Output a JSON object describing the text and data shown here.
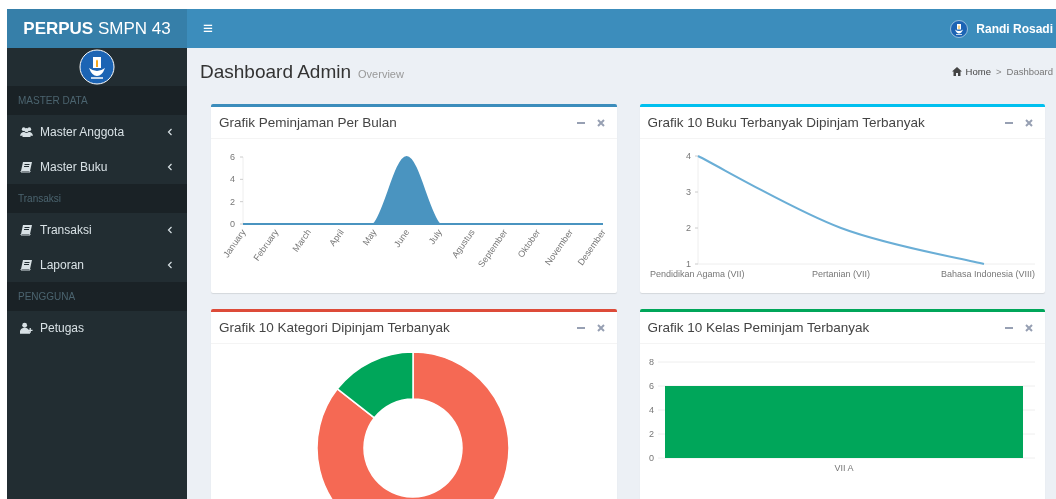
{
  "header": {
    "brand": "**PERPUS** SMPN 43",
    "menu_toggle": "≡",
    "user_name": "Randi Rosadi"
  },
  "sidebar": {
    "sections": [
      {
        "header": "MASTER DATA",
        "items": [
          {
            "label": "Master Anggota",
            "kind": "users",
            "expanded": false
          },
          {
            "label": "Master Buku",
            "kind": "book",
            "expanded": false
          }
        ]
      },
      {
        "header": "Transaksi",
        "items": [
          {
            "label": "Transaksi",
            "kind": "book",
            "expanded": false
          },
          {
            "label": "Laporan",
            "kind": "book",
            "expanded": false
          }
        ]
      },
      {
        "header": "PENGGUNA",
        "items": [
          {
            "label": "Petugas",
            "kind": "adduser"
          }
        ]
      }
    ]
  },
  "page_header": {
    "title": "Dashboard Admin",
    "subtitle": "Overview",
    "breadcrumb": [
      {
        "label": "Home"
      },
      {
        "label": "Dashboard"
      }
    ],
    "separator": ">"
  },
  "cards": [
    {
      "title": "Grafik Peminjaman Per Bulan",
      "color": "#3c8dbc",
      "chart_data": {
        "type": "area",
        "categories": [
          "January",
          "February",
          "March",
          "April",
          "May",
          "June",
          "July",
          "Agustus",
          "September",
          "Oktober",
          "November",
          "Desember"
        ],
        "series": [
          {
            "color": "#4a94c0",
            "values": [
              0,
              0,
              0,
              0,
              0,
              6,
              0,
              0,
              0,
              0,
              0,
              0
            ]
          }
        ],
        "ylim": [
          0,
          6
        ],
        "yticks": [
          0,
          2,
          4,
          6
        ]
      }
    },
    {
      "title": "Grafik 10 Buku Terbanyak Dipinjam Terbanyak",
      "color": "#00c0ef",
      "chart_data": {
        "type": "line",
        "categories": [
          "Pendidikan Agama (VII)",
          "Pertanian (VII)",
          "Bahasa Indonesia (VIII)"
        ],
        "series": [
          {
            "color": "#6aaed6",
            "values": [
              4,
              2,
              1
            ]
          }
        ],
        "ylim": [
          1,
          4
        ],
        "yticks": [
          1,
          2,
          3,
          4
        ]
      }
    },
    {
      "title": "Grafik 10 Kategori Dipinjam Terbanyak",
      "color": "#dd4b39",
      "kind": "donut"
    },
    {
      "title": "Grafik 10 Kelas Peminjam Terbanyak",
      "color": "#00a65a",
      "chart_data": {
        "type": "bar",
        "grid": true,
        "categories": [
          "VII A"
        ],
        "series": [
          {
            "color": "#00a65a",
            "values": [
              6
            ]
          }
        ],
        "ylim": [
          0,
          8
        ],
        "yticks": [
          0,
          2,
          4,
          6,
          8
        ]
      }
    }
  ]
}
